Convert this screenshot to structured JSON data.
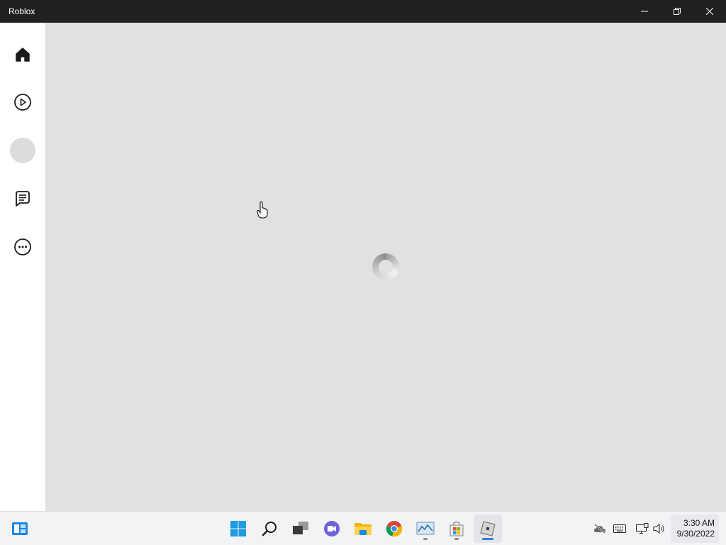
{
  "window": {
    "title": "Roblox",
    "controls": [
      "minimize-icon",
      "restore-icon",
      "close-icon"
    ]
  },
  "sidebar": {
    "items": [
      {
        "name": "home",
        "icon": "home-icon"
      },
      {
        "name": "discover",
        "icon": "play-circle-icon"
      },
      {
        "name": "avatar",
        "icon": "avatar-placeholder"
      },
      {
        "name": "chat",
        "icon": "chat-icon"
      },
      {
        "name": "more",
        "icon": "more-icon"
      }
    ]
  },
  "main": {
    "state": "loading",
    "spinner_icon": "loading-spinner"
  },
  "taskbar": {
    "widgets_icon": "widgets-icon",
    "apps": [
      "start-icon",
      "search-icon",
      "task-view-icon",
      "teams-chat-icon",
      "file-explorer-icon",
      "chrome-icon",
      "task-manager-icon",
      "store-icon",
      "roblox-icon"
    ],
    "active_app": "roblox-icon",
    "tray": [
      "cloud-offline-icon",
      "keyboard-icon",
      "network-icon",
      "volume-icon"
    ],
    "clock": {
      "time": "3:30 AM",
      "date": "9/30/2022"
    }
  },
  "colors": {
    "titlebar": "#202020",
    "content_bg": "#e1e1e1",
    "sidebar_bg": "#ffffff",
    "taskbar_bg": "#f2f3f5",
    "accent": "#2f7fd8"
  }
}
